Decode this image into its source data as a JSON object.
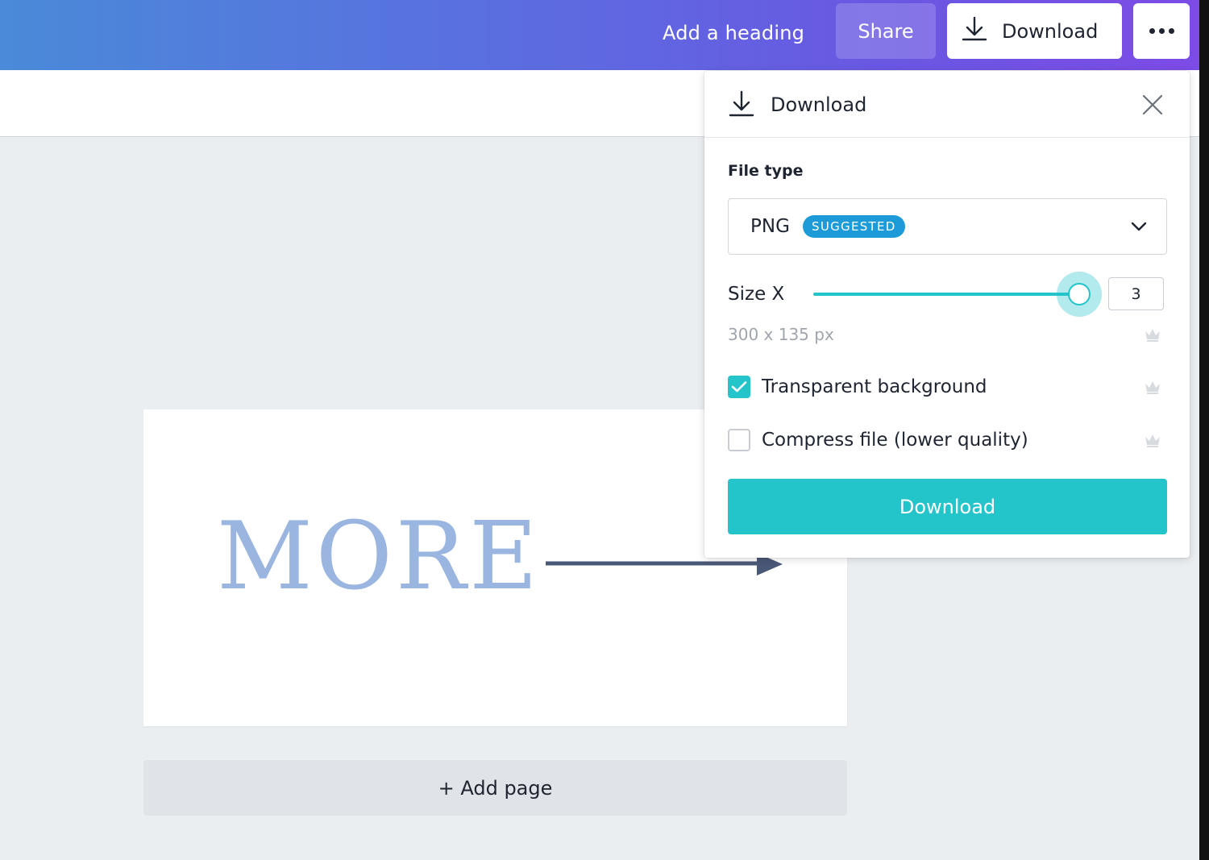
{
  "header": {
    "heading_link": "Add a heading",
    "share_label": "Share",
    "download_label": "Download"
  },
  "canvas": {
    "page_text": "MORE",
    "add_page_label": "+ Add page"
  },
  "download_panel": {
    "title": "Download",
    "file_type_label": "File type",
    "file_type_value": "PNG",
    "file_type_badge": "SUGGESTED",
    "size_label": "Size X",
    "size_value": "3",
    "slider_fraction": 1.0,
    "dimensions": "300 x 135 px",
    "options": [
      {
        "label": "Transparent background",
        "checked": true
      },
      {
        "label": "Compress file (lower quality)",
        "checked": false
      }
    ],
    "download_button": "Download"
  },
  "colors": {
    "accent": "#23c4ca",
    "badge": "#1d9bd8",
    "header_start": "#4a8ad8",
    "header_end": "#7d4be6"
  },
  "icons": [
    "download-icon",
    "more-icon",
    "close-icon",
    "chevron-down-icon",
    "check-icon",
    "crown-icon",
    "arrow-right-icon"
  ]
}
